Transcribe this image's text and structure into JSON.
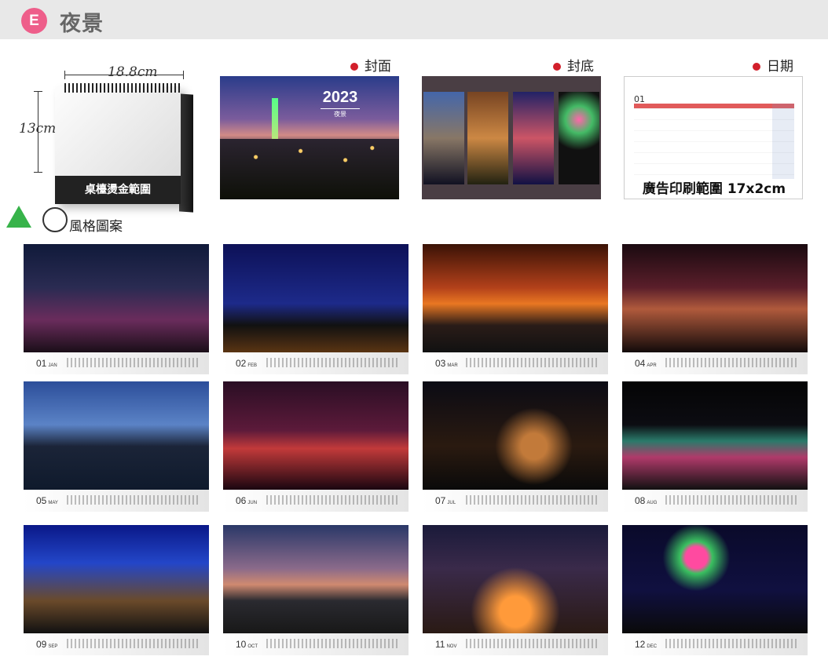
{
  "header": {
    "badge": "E",
    "title": "夜景"
  },
  "desk_calendar": {
    "width_label": "18.8cm",
    "height_label": "13cm",
    "print_area_label": "桌檯燙金範圍"
  },
  "style_section_label": "風格圖案",
  "sections": [
    {
      "label": "封面"
    },
    {
      "label": "封底"
    },
    {
      "label": "日期"
    }
  ],
  "cover": {
    "year": "2023",
    "subtitle": "夜景"
  },
  "date_panel": {
    "month": "01",
    "ad_text": "廣告印刷範圍 17x2cm"
  },
  "months": [
    {
      "num": "01",
      "abbr": "JAN"
    },
    {
      "num": "02",
      "abbr": "FEB"
    },
    {
      "num": "03",
      "abbr": "MAR"
    },
    {
      "num": "04",
      "abbr": "APR"
    },
    {
      "num": "05",
      "abbr": "MAY"
    },
    {
      "num": "06",
      "abbr": "JUN"
    },
    {
      "num": "07",
      "abbr": "JUL"
    },
    {
      "num": "08",
      "abbr": "AUG"
    },
    {
      "num": "09",
      "abbr": "SEP"
    },
    {
      "num": "10",
      "abbr": "OCT"
    },
    {
      "num": "11",
      "abbr": "NOV"
    },
    {
      "num": "12",
      "abbr": "DEC"
    }
  ],
  "colors": {
    "badge": "#ee5e8a",
    "accent_dot": "#d21f2b",
    "header_bg": "#e8e8e8"
  }
}
